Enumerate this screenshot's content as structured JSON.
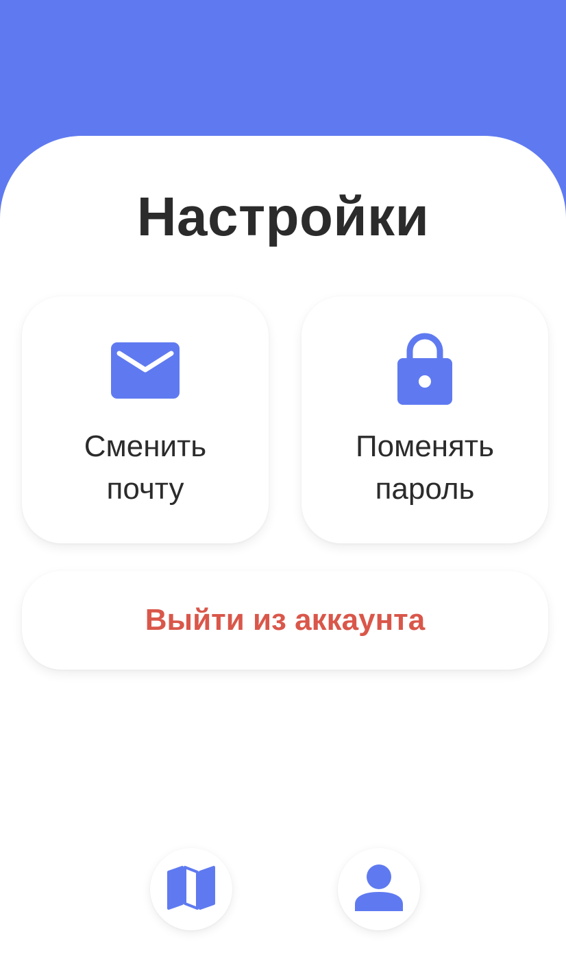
{
  "header": {
    "title": "Настройки"
  },
  "cards": {
    "email": {
      "label_line1": "Сменить",
      "label_line2": "почту",
      "icon": "mail-icon"
    },
    "password": {
      "label_line1": "Поменять",
      "label_line2": "пароль",
      "icon": "lock-icon"
    }
  },
  "logout": {
    "label": "Выйти из аккаунта"
  },
  "bottom_nav": {
    "items": [
      {
        "icon": "map-icon"
      },
      {
        "icon": "user-icon"
      }
    ]
  },
  "colors": {
    "accent": "#5f7af0",
    "danger": "#d9574a",
    "text": "#2b2b2b",
    "background": "#ffffff"
  }
}
